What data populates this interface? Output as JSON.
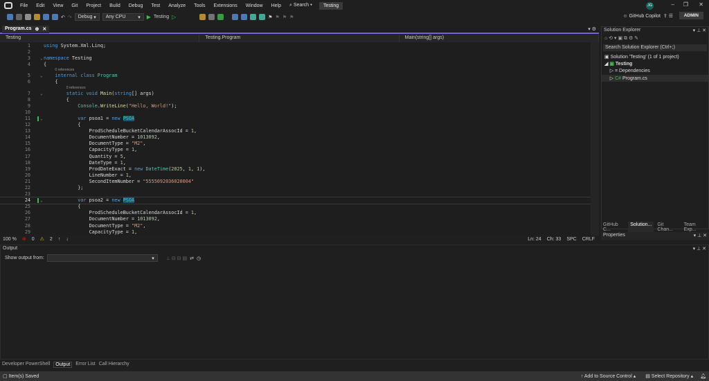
{
  "menu": [
    "File",
    "Edit",
    "View",
    "Git",
    "Project",
    "Build",
    "Debug",
    "Test",
    "Analyze",
    "Tools",
    "Extensions",
    "Window",
    "Help"
  ],
  "search_label": "Search",
  "solution_name": "Testing",
  "user_initials": "JG",
  "toolbar": {
    "config": "Debug",
    "platform": "Any CPU",
    "start_target": "Testing",
    "copilot": "GitHub Copilot",
    "admin": "ADMIN"
  },
  "tab": {
    "name": "Program.cs"
  },
  "nav": {
    "project": "Testing",
    "type": "Testing.Program",
    "member": "Main(string[] args)"
  },
  "editor": {
    "codelens": "0 references",
    "zoom": "100 %",
    "errors": "0",
    "warnings": "2",
    "ln": "Ln: 24",
    "ch": "Ch: 33",
    "spc": "SPC",
    "eol": "CRLF"
  },
  "code": [
    {
      "n": "1",
      "i": 0,
      "t": [
        [
          "using ",
          "kw"
        ],
        [
          "System.Xml.Linq;",
          "pl"
        ]
      ]
    },
    {
      "n": "2",
      "i": 0,
      "t": []
    },
    {
      "n": "3",
      "i": 0,
      "t": [
        [
          "namespace ",
          "kw"
        ],
        [
          "Testing",
          "pl"
        ]
      ]
    },
    {
      "n": "4",
      "i": 0,
      "t": [
        [
          "{",
          "pl"
        ]
      ]
    },
    {
      "n": "5",
      "i": 4,
      "lens": true,
      "t": [
        [
          "internal ",
          "kw"
        ],
        [
          "class ",
          "kw"
        ],
        [
          "Program",
          "ty"
        ]
      ]
    },
    {
      "n": "6",
      "i": 4,
      "t": [
        [
          "{",
          "pl"
        ]
      ]
    },
    {
      "n": "7",
      "i": 8,
      "lens": true,
      "t": [
        [
          "static ",
          "kw"
        ],
        [
          "void ",
          "kw"
        ],
        [
          "Main",
          "me"
        ],
        [
          "(",
          "pl"
        ],
        [
          "string",
          "kw"
        ],
        [
          "[] args)",
          "pl"
        ]
      ]
    },
    {
      "n": "8",
      "i": 8,
      "t": [
        [
          "{",
          "pl"
        ]
      ]
    },
    {
      "n": "9",
      "i": 12,
      "t": [
        [
          "Console",
          "ty"
        ],
        [
          ".",
          "pl"
        ],
        [
          "WriteLine",
          "me"
        ],
        [
          "(",
          "pl"
        ],
        [
          "\"Hello, World!\"",
          "st"
        ],
        [
          ");",
          "pl"
        ]
      ]
    },
    {
      "n": "10",
      "i": 0,
      "t": []
    },
    {
      "n": "11",
      "i": 12,
      "m": true,
      "t": [
        [
          "var ",
          "kw"
        ],
        [
          "psoa1 = ",
          "pl"
        ],
        [
          "new ",
          "kw"
        ],
        [
          "PSOA",
          "hl"
        ]
      ]
    },
    {
      "n": "12",
      "i": 12,
      "t": [
        [
          "{",
          "pl"
        ]
      ]
    },
    {
      "n": "13",
      "i": 16,
      "t": [
        [
          "ProdScheduleBucketCalendarAssocId = ",
          "pl"
        ],
        [
          "1",
          "nu"
        ],
        [
          ",",
          "pl"
        ]
      ]
    },
    {
      "n": "14",
      "i": 16,
      "t": [
        [
          "DocumentNumber = ",
          "pl"
        ],
        [
          "1013092",
          "nu"
        ],
        [
          ",",
          "pl"
        ]
      ]
    },
    {
      "n": "15",
      "i": 16,
      "t": [
        [
          "DocumentType = ",
          "pl"
        ],
        [
          "\"M2\"",
          "st"
        ],
        [
          ",",
          "pl"
        ]
      ]
    },
    {
      "n": "16",
      "i": 16,
      "t": [
        [
          "CapacityType = ",
          "pl"
        ],
        [
          "1",
          "nu"
        ],
        [
          ",",
          "pl"
        ]
      ]
    },
    {
      "n": "17",
      "i": 16,
      "t": [
        [
          "Quantity = ",
          "pl"
        ],
        [
          "5",
          "nu"
        ],
        [
          ",",
          "pl"
        ]
      ]
    },
    {
      "n": "18",
      "i": 16,
      "t": [
        [
          "DateType = ",
          "pl"
        ],
        [
          "1",
          "nu"
        ],
        [
          ",",
          "pl"
        ]
      ]
    },
    {
      "n": "19",
      "i": 16,
      "t": [
        [
          "ProdDateExact = ",
          "pl"
        ],
        [
          "new ",
          "kw"
        ],
        [
          "DateTime",
          "ty"
        ],
        [
          "(",
          "pl"
        ],
        [
          "2025",
          "nu"
        ],
        [
          ", ",
          "pl"
        ],
        [
          "1",
          "nu"
        ],
        [
          ", ",
          "pl"
        ],
        [
          "1",
          "nu"
        ],
        [
          "),",
          "pl"
        ]
      ]
    },
    {
      "n": "20",
      "i": 16,
      "t": [
        [
          "LineNumber = ",
          "pl"
        ],
        [
          "1",
          "nu"
        ],
        [
          ",",
          "pl"
        ]
      ]
    },
    {
      "n": "21",
      "i": 16,
      "t": [
        [
          "SecondItemNumber = ",
          "pl"
        ],
        [
          "\"5555092036020004\"",
          "st"
        ]
      ]
    },
    {
      "n": "22",
      "i": 12,
      "t": [
        [
          "};",
          "pl"
        ]
      ]
    },
    {
      "n": "23",
      "i": 0,
      "t": []
    },
    {
      "n": "24",
      "i": 12,
      "m": true,
      "cur": true,
      "t": [
        [
          "var ",
          "kw"
        ],
        [
          "psoa2 = ",
          "pl"
        ],
        [
          "new ",
          "kw"
        ],
        [
          "PSOA",
          "hl"
        ]
      ]
    },
    {
      "n": "25",
      "i": 12,
      "t": [
        [
          "{",
          "pl"
        ]
      ]
    },
    {
      "n": "26",
      "i": 16,
      "t": [
        [
          "ProdScheduleBucketCalendarAssocId = ",
          "pl"
        ],
        [
          "1",
          "nu"
        ],
        [
          ",",
          "pl"
        ]
      ]
    },
    {
      "n": "27",
      "i": 16,
      "t": [
        [
          "DocumentNumber = ",
          "pl"
        ],
        [
          "1013092",
          "nu"
        ],
        [
          ",",
          "pl"
        ]
      ]
    },
    {
      "n": "28",
      "i": 16,
      "t": [
        [
          "DocumentType = ",
          "pl"
        ],
        [
          "\"M2\"",
          "st"
        ],
        [
          ",",
          "pl"
        ]
      ]
    },
    {
      "n": "29",
      "i": 16,
      "t": [
        [
          "CapacityType = ",
          "pl"
        ],
        [
          "1",
          "nu"
        ],
        [
          ",",
          "pl"
        ]
      ]
    }
  ],
  "solution_explorer": {
    "title": "Solution Explorer",
    "search_placeholder": "Search Solution Explorer (Ctrl+;)",
    "items": [
      "Solution 'Testing' (1 of 1 project)",
      "Testing",
      "Dependencies",
      "Program.cs"
    ]
  },
  "right_tabs": [
    "GitHub C...",
    "Solution...",
    "Git Chan...",
    "Team Exp..."
  ],
  "properties": {
    "title": "Properties"
  },
  "output": {
    "title": "Output",
    "show_from": "Show output from:"
  },
  "bottom_tabs": [
    "Developer PowerShell",
    "Output",
    "Error List",
    "Call Hierarchy"
  ],
  "status": {
    "message": "Item(s) Saved",
    "source_control": "Add to Source Control",
    "repo": "Select Repository"
  }
}
